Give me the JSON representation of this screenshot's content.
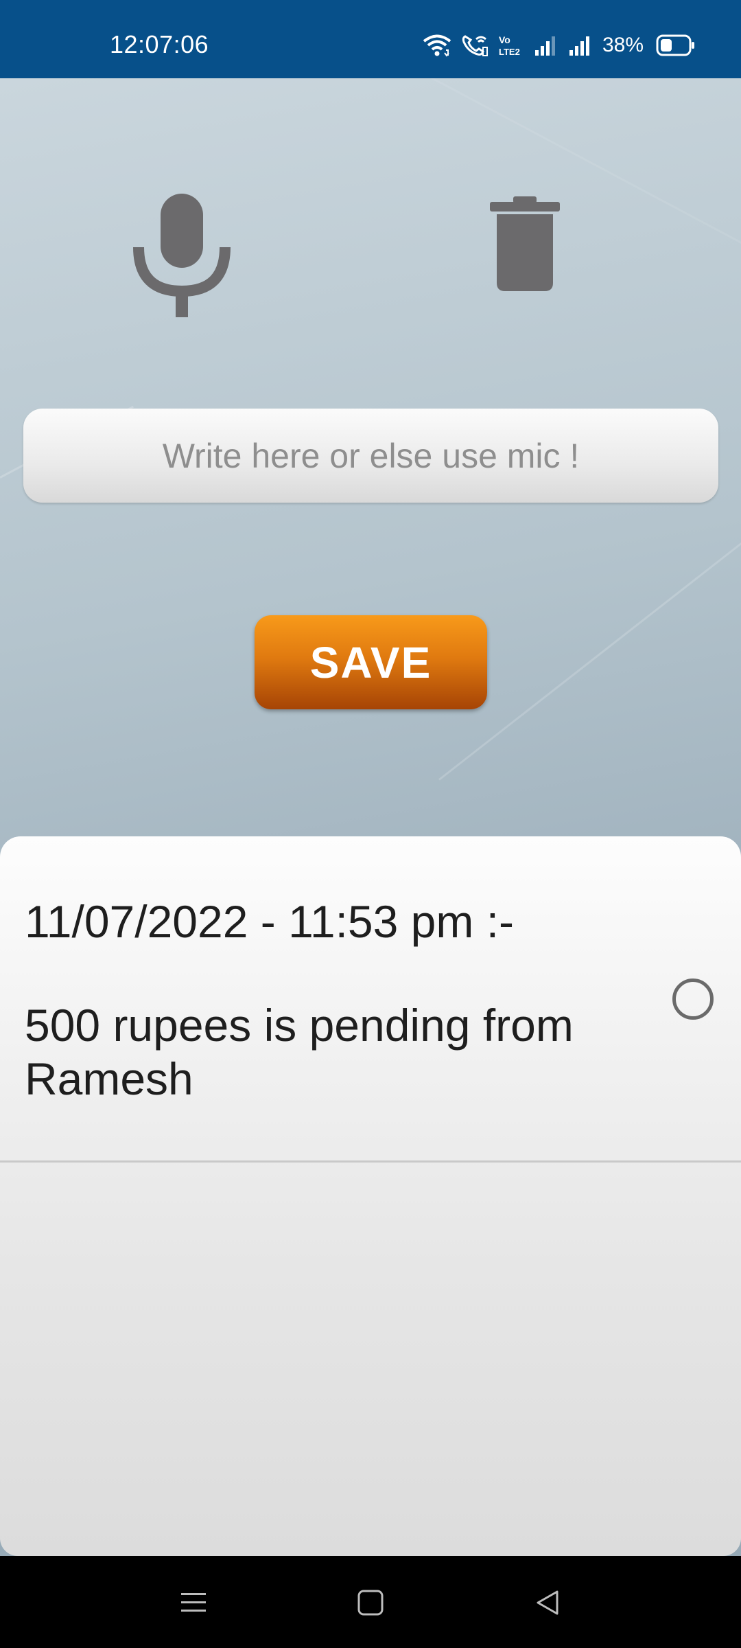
{
  "status_bar": {
    "time": "12:07:06",
    "battery_percent": "38%",
    "icons": [
      "wifi-icon",
      "wifi-calling-icon",
      "volte-icon",
      "signal-icon-sim1",
      "signal-icon-sim2",
      "battery-icon"
    ]
  },
  "toolbar": {
    "mic_icon": "microphone-icon",
    "delete_icon": "trash-icon"
  },
  "input": {
    "placeholder": "Write here or else use mic !",
    "value": ""
  },
  "save_button": {
    "label": "SAVE"
  },
  "notes": [
    {
      "timestamp": "11/07/2022 - 11:53 pm :-",
      "text": "500 rupees is pending from Ramesh",
      "selected": false
    }
  ],
  "nav_bar": {
    "icons": [
      "menu-icon",
      "home-icon",
      "back-icon"
    ]
  },
  "colors": {
    "status_bar": "#07508a",
    "save_button_top": "#f89a1a",
    "save_button_bottom": "#a64405",
    "icon_gray": "#6b6a6c"
  }
}
